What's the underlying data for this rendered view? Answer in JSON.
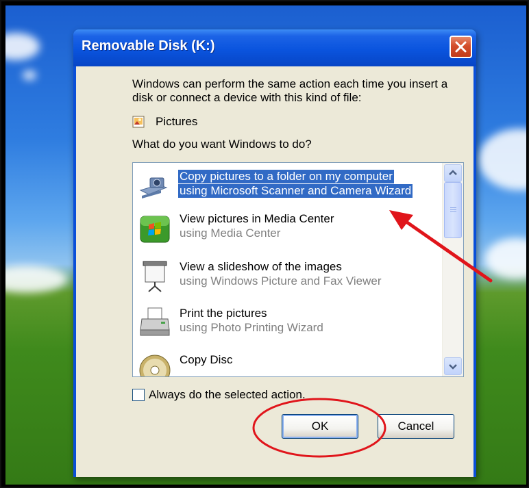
{
  "dialog": {
    "title": "Removable Disk (K:)",
    "message": "Windows can perform the same action each time you insert a disk or connect a device with this kind of file:",
    "content_type": "Pictures",
    "question": "What do you want Windows to do?",
    "actions": [
      {
        "title": "Copy pictures to a folder on my computer",
        "subtitle": "using Microsoft Scanner and Camera Wizard",
        "icon": "camera-icon",
        "selected": true
      },
      {
        "title": "View pictures in Media Center",
        "subtitle": "using Media Center",
        "icon": "media-center-icon",
        "selected": false
      },
      {
        "title": "View a slideshow of the images",
        "subtitle": "using Windows Picture and Fax Viewer",
        "icon": "projector-screen-icon",
        "selected": false
      },
      {
        "title": "Print the pictures",
        "subtitle": "using Photo Printing Wizard",
        "icon": "printer-icon",
        "selected": false
      },
      {
        "title": "Copy Disc",
        "subtitle": "",
        "icon": "disc-icon",
        "selected": false
      }
    ],
    "always_label": "Always do the selected action.",
    "always_checked": false,
    "ok_label": "OK",
    "cancel_label": "Cancel"
  },
  "colors": {
    "title_bar": "#0a54de",
    "selection": "#316ac5",
    "dialog_face": "#ece9d8",
    "annotation": "#e0151b"
  }
}
